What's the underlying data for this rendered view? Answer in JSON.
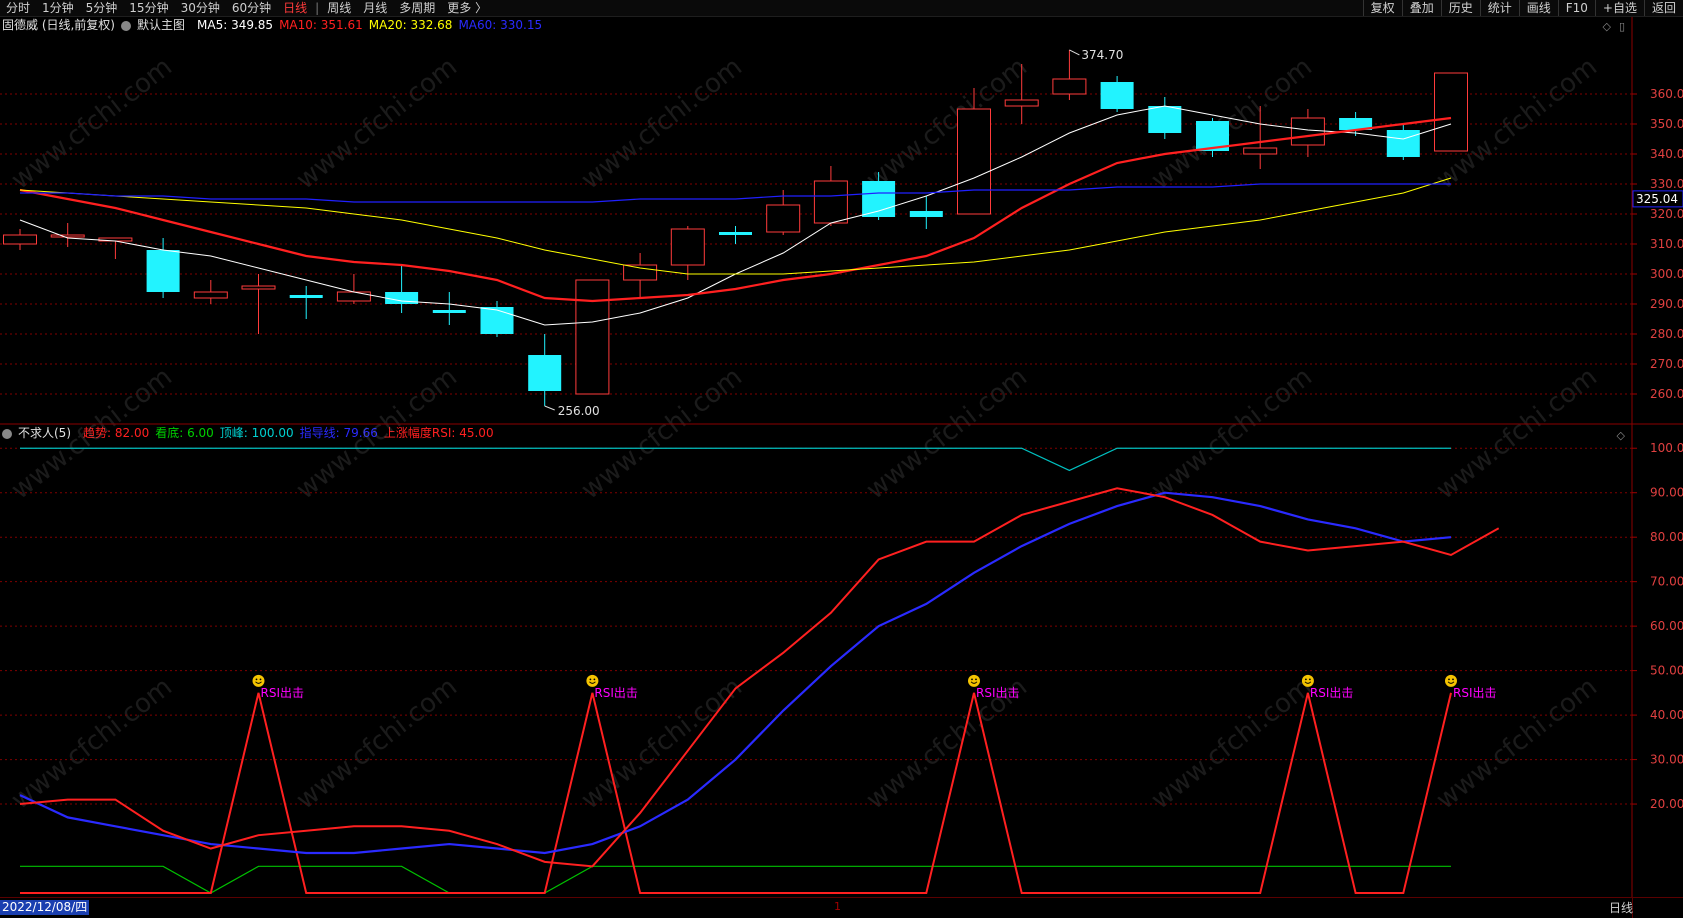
{
  "toolbar": {
    "left_items": [
      "分时",
      "1分钟",
      "5分钟",
      "15分钟",
      "30分钟",
      "60分钟",
      "日线",
      "周线",
      "月线",
      "多周期",
      "更多 〉"
    ],
    "active_item": "日线",
    "right_items": [
      "复权",
      "叠加",
      "历史",
      "统计",
      "画线",
      "F10",
      "+自选",
      "返回"
    ],
    "separator": "|"
  },
  "main_legend": {
    "stock_name": "固德威 (日线,前复权)",
    "template": "默认主图",
    "ma5": "MA5: 349.85",
    "ma10": "MA10: 351.61",
    "ma20": "MA20: 332.68",
    "ma60": "MA60: 330.15"
  },
  "indicator_legend": {
    "name": "不求人(5)",
    "trend": "趋势: 82.00",
    "bottom": "看底: 6.00",
    "top": "顶峰: 100.00",
    "guide": "指导线: 79.66",
    "rsi": "上涨幅度RSI: 45.00"
  },
  "bottom": {
    "date": "2022/12/08/四",
    "period": "日线",
    "cursor_mark": "1"
  },
  "watermark": "www.cfchi.com",
  "colors": {
    "up": "#ff3b3b",
    "down": "#22f3ff",
    "ma5": "#ffffff",
    "ma10": "#ff2020",
    "ma20": "#ffff00",
    "ma60": "#2020ff",
    "grid": "#800000",
    "trend": "#ff2020",
    "bottom_line": "#00c000",
    "top_line": "#00c0c0",
    "guide": "#2a2aff",
    "rsi_label": "#ff00ff"
  },
  "chart_data": [
    {
      "type": "candlestick",
      "title": "固德威 (日线,前复权)",
      "ylim": [
        252,
        380
      ],
      "yticks": [
        "260.0",
        "270.0",
        "280.0",
        "290.0",
        "300.0",
        "310.0",
        "320.0",
        "330.0",
        "340.0",
        "350.0",
        "360.0"
      ],
      "current_price": "325.04",
      "high_label": "374.70",
      "low_label": "256.00",
      "high_index": 22,
      "low_index": 11,
      "candles": [
        {
          "o": 310,
          "c": 313,
          "h": 315,
          "l": 308
        },
        {
          "o": 313,
          "c": 313,
          "h": 317,
          "l": 309
        },
        {
          "o": 311,
          "c": 312,
          "h": 312,
          "l": 305
        },
        {
          "o": 308,
          "c": 294,
          "h": 312,
          "l": 292
        },
        {
          "o": 292,
          "c": 294,
          "h": 298,
          "l": 290
        },
        {
          "o": 295,
          "c": 296,
          "h": 300,
          "l": 280
        },
        {
          "o": 293,
          "c": 292,
          "h": 296,
          "l": 285
        },
        {
          "o": 291,
          "c": 294,
          "h": 300,
          "l": 290
        },
        {
          "o": 294,
          "c": 290,
          "h": 303,
          "l": 287
        },
        {
          "o": 288,
          "c": 287,
          "h": 294,
          "l": 283
        },
        {
          "o": 289,
          "c": 280,
          "h": 291,
          "l": 279
        },
        {
          "o": 273,
          "c": 261,
          "h": 280,
          "l": 256
        },
        {
          "o": 260,
          "c": 298,
          "h": 298,
          "l": 260
        },
        {
          "o": 298,
          "c": 303,
          "h": 307,
          "l": 292
        },
        {
          "o": 303,
          "c": 315,
          "h": 316,
          "l": 298
        },
        {
          "o": 314,
          "c": 313,
          "h": 316,
          "l": 310
        },
        {
          "o": 314,
          "c": 323,
          "h": 328,
          "l": 313
        },
        {
          "o": 317,
          "c": 331,
          "h": 336,
          "l": 316
        },
        {
          "o": 331,
          "c": 319,
          "h": 334,
          "l": 318
        },
        {
          "o": 321,
          "c": 319,
          "h": 326,
          "l": 315
        },
        {
          "o": 320,
          "c": 355,
          "h": 362,
          "l": 320
        },
        {
          "o": 356,
          "c": 358,
          "h": 370,
          "l": 350
        },
        {
          "o": 360,
          "c": 365,
          "h": 374.7,
          "l": 358
        },
        {
          "o": 364,
          "c": 355,
          "h": 366,
          "l": 354
        },
        {
          "o": 356,
          "c": 347,
          "h": 359,
          "l": 345
        },
        {
          "o": 351,
          "c": 341,
          "h": 352,
          "l": 339
        },
        {
          "o": 340,
          "c": 342,
          "h": 356,
          "l": 335
        },
        {
          "o": 343,
          "c": 352,
          "h": 355,
          "l": 339
        },
        {
          "o": 352,
          "c": 348,
          "h": 354,
          "l": 346
        },
        {
          "o": 348,
          "c": 339,
          "h": 350,
          "l": 338
        },
        {
          "o": 341,
          "c": 367,
          "h": 367,
          "l": 341
        }
      ],
      "series": [
        {
          "name": "MA5",
          "values": [
            318,
            312,
            311,
            308,
            306,
            302,
            298,
            294,
            291,
            290,
            288,
            283,
            284,
            287,
            292,
            300,
            307,
            317,
            321,
            326,
            332,
            339,
            347,
            353,
            356,
            353,
            350,
            348,
            347,
            345,
            350
          ]
        },
        {
          "name": "MA10",
          "values": [
            328,
            325,
            322,
            318,
            314,
            310,
            306,
            304,
            303,
            301,
            298,
            292,
            291,
            292,
            293,
            295,
            298,
            300,
            303,
            306,
            312,
            322,
            330,
            337,
            340,
            342,
            344,
            346,
            348,
            350,
            352
          ]
        },
        {
          "name": "MA20",
          "values": [
            328,
            327,
            326,
            325,
            324,
            323,
            322,
            320,
            318,
            315,
            312,
            308,
            305,
            302,
            300,
            300,
            300,
            301,
            302,
            303,
            304,
            306,
            308,
            311,
            314,
            316,
            318,
            321,
            324,
            327,
            332
          ]
        },
        {
          "name": "MA60",
          "values": [
            327,
            327,
            326,
            326,
            325,
            325,
            325,
            324,
            324,
            324,
            324,
            324,
            324,
            325,
            325,
            325,
            326,
            326,
            327,
            327,
            328,
            328,
            328,
            329,
            329,
            329,
            330,
            330,
            330,
            330,
            330
          ]
        }
      ]
    },
    {
      "type": "line",
      "title": "不求人(5)",
      "ylim": [
        0,
        105
      ],
      "yticks": [
        "20.00",
        "30.00",
        "40.00",
        "50.00",
        "60.00",
        "70.00",
        "80.00",
        "90.00",
        "100.0"
      ],
      "signal_label": "RSI出击",
      "signal_indices": [
        5,
        12,
        20,
        27,
        30
      ],
      "series": [
        {
          "name": "趋势",
          "values": [
            20,
            21,
            21,
            14,
            10,
            13,
            14,
            15,
            15,
            14,
            11,
            7,
            6,
            18,
            32,
            46,
            54,
            63,
            75,
            79,
            79,
            85,
            88,
            91,
            89,
            85,
            79,
            77,
            78,
            79,
            76,
            82
          ]
        },
        {
          "name": "看底",
          "values": [
            6,
            6,
            6,
            6,
            0,
            6,
            6,
            6,
            6,
            0,
            0,
            0,
            6,
            6,
            6,
            6,
            6,
            6,
            6,
            6,
            6,
            6,
            6,
            6,
            6,
            6,
            6,
            6,
            6,
            6,
            6
          ]
        },
        {
          "name": "顶峰",
          "values": [
            100,
            100,
            100,
            100,
            100,
            100,
            100,
            100,
            100,
            100,
            100,
            100,
            100,
            100,
            100,
            100,
            100,
            100,
            100,
            100,
            100,
            100,
            95,
            100,
            100,
            100,
            100,
            100,
            100,
            100,
            100
          ]
        },
        {
          "name": "指导线",
          "values": [
            22,
            17,
            15,
            13,
            11,
            10,
            9,
            9,
            10,
            11,
            10,
            9,
            11,
            15,
            21,
            30,
            41,
            51,
            60,
            65,
            72,
            78,
            83,
            87,
            90,
            89,
            87,
            84,
            82,
            79,
            80
          ]
        },
        {
          "name": "上涨幅度RSI",
          "values": [
            0,
            0,
            0,
            0,
            0,
            45,
            0,
            0,
            0,
            0,
            0,
            0,
            45,
            0,
            0,
            0,
            0,
            0,
            0,
            0,
            45,
            0,
            0,
            0,
            0,
            0,
            0,
            45,
            0,
            0,
            45
          ]
        }
      ]
    }
  ]
}
